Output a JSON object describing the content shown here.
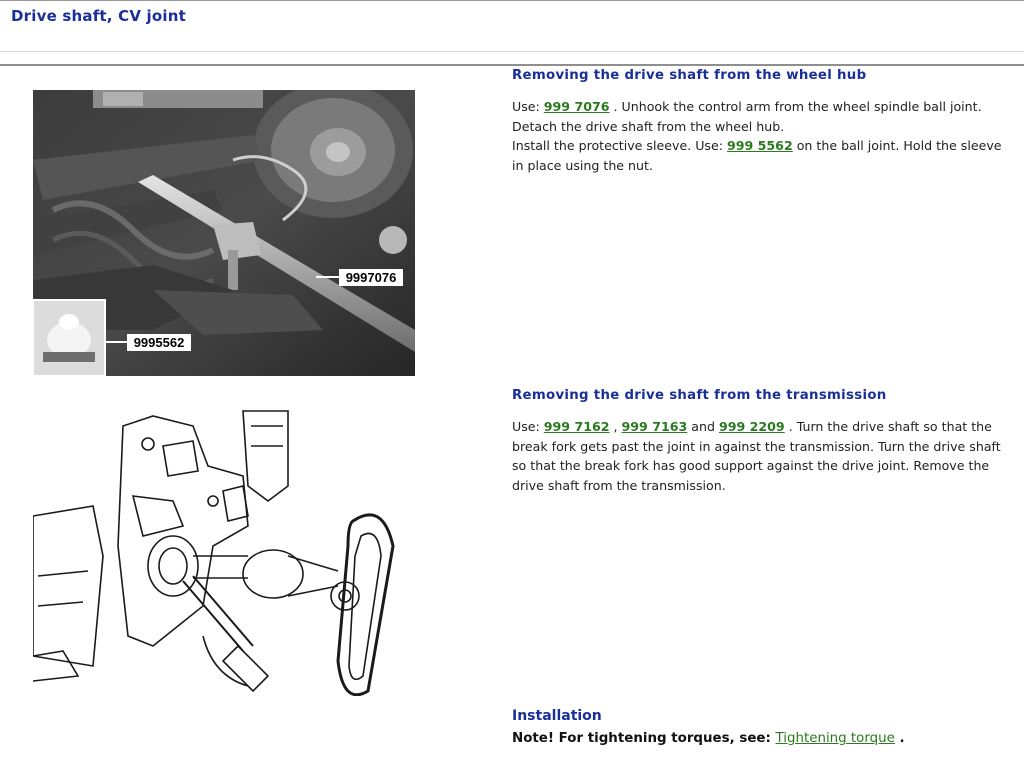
{
  "header": {
    "title": "Drive shaft, CV joint"
  },
  "figures": {
    "photo": {
      "callout_1": "9997076",
      "callout_2": "9995562"
    }
  },
  "sections": [
    {
      "heading": "Removing the drive shaft from the wheel hub",
      "line1_prefix": "Use: ",
      "tool_1": "999 7076",
      "line1_suffix": " . Unhook the control arm from the wheel spindle ball joint. Detach the drive shaft from the wheel hub.",
      "line2_prefix": "Install the protective sleeve. Use: ",
      "tool_2": "999 5562",
      "line2_suffix": " on the ball joint. Hold the sleeve in place using the nut."
    },
    {
      "heading": "Removing the drive shaft from the transmission",
      "prefix": "Use: ",
      "tool_1": "999 7162",
      "sep_1": " , ",
      "tool_2": "999 7163",
      "sep_2": " and ",
      "tool_3": "999 2209",
      "suffix": " . Turn the drive shaft so that the break fork gets past the joint in against the transmission. Turn the drive shaft so that the break fork has good support against the drive joint. Remove the drive shaft from the transmission."
    }
  ],
  "installation": {
    "heading": "Installation",
    "note_prefix": "Note! For tightening torques, see: ",
    "link": "Tightening torque",
    "note_suffix": " ."
  }
}
